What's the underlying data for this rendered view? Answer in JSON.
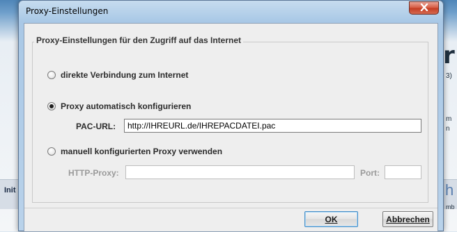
{
  "background": {
    "left_text": "Init",
    "right_letter": "r",
    "right_snippet1": "3)",
    "right_snippet2": "m\nn",
    "right_h": "h",
    "right_small": "mb"
  },
  "dialog": {
    "title": "Proxy-Einstellungen",
    "close_icon": "close-icon",
    "group_title": "Proxy-Einstellungen für den Zugriff auf das Internet",
    "options": [
      {
        "label": "direkte Verbindung zum Internet",
        "checked": false
      },
      {
        "label": "Proxy automatisch konfigurieren",
        "checked": true
      },
      {
        "label": "manuell konfigurierten Proxy verwenden",
        "checked": false
      }
    ],
    "pac_label": "PAC-URL:",
    "pac_value": "http://IHREURL.de/IHREPACDATEI.pac",
    "http_proxy_label": "HTTP-Proxy:",
    "http_proxy_value": "",
    "port_label": "Port:",
    "port_value": "",
    "ok_label": "OK",
    "cancel_label": "Abbrechen"
  }
}
